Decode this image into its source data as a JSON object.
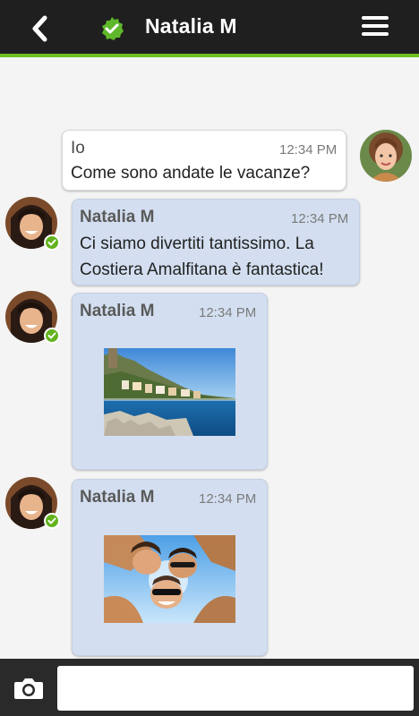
{
  "header": {
    "title": "Natalia M",
    "back_icon": "chevron-left-icon",
    "status_icon": "verified-check-icon",
    "menu_icon": "hamburger-menu-icon"
  },
  "messages": [
    {
      "sender": "Io",
      "time": "12:34 PM",
      "text": "Come sono andate le vacanze?",
      "direction": "outgoing"
    },
    {
      "sender": "Natalia M",
      "time": "12:34 PM",
      "text_line1": "Ci siamo divertiti tantissimo. La",
      "text_line2": "Costiera Amalfitana è fantastica!",
      "direction": "incoming"
    },
    {
      "sender": "Natalia M",
      "time": "12:34 PM",
      "attachment": "photo-coastline",
      "direction": "incoming"
    },
    {
      "sender": "Natalia M",
      "time": "12:34 PM",
      "attachment": "photo-friends",
      "direction": "incoming"
    }
  ],
  "composer": {
    "camera_icon": "camera-icon",
    "placeholder": ""
  },
  "colors": {
    "accent": "#6fbf1e",
    "header_bg": "#1f1f1f",
    "incoming_bubble": "#d3dff0",
    "outgoing_bubble": "#ffffff"
  }
}
